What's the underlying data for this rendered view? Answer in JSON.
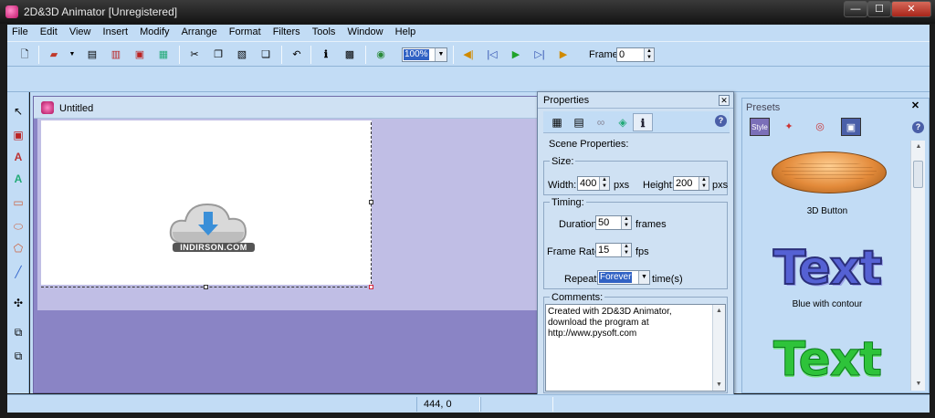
{
  "window": {
    "title": "2D&3D Animator [Unregistered]",
    "min": "—",
    "max": "☐",
    "close": "✕"
  },
  "menu": [
    "File",
    "Edit",
    "View",
    "Insert",
    "Modify",
    "Arrange",
    "Format",
    "Filters",
    "Tools",
    "Window",
    "Help"
  ],
  "toolbar": {
    "zoom_value": "100%",
    "frame_label": "Frame:",
    "frame_value": "0"
  },
  "document": {
    "title": "Untitled",
    "logo_text": "INDIRSON.COM"
  },
  "properties": {
    "title": "Properties",
    "close": "✕",
    "help": "?",
    "scene_label": "Scene Properties:",
    "size": {
      "group": "Size:",
      "width_label": "Width:",
      "width_value": "400",
      "width_unit": "pxs",
      "height_label": "Height:",
      "height_value": "200",
      "height_unit": "pxs"
    },
    "timing": {
      "group": "Timing:",
      "duration_label": "Duration:",
      "duration_value": "50",
      "duration_unit": "frames",
      "framerate_label": "Frame Rate:",
      "framerate_value": "15",
      "framerate_unit": "fps",
      "repeat_label": "Repeat:",
      "repeat_value": "Forever",
      "repeat_unit": "time(s)"
    },
    "comments": {
      "group": "Comments:",
      "text": "Created with 2D&3D Animator, download the program at http://www.pysoft.com"
    }
  },
  "presets": {
    "title": "Presets",
    "close": "✕",
    "help": "?",
    "style_tab": "Style",
    "items": [
      {
        "caption": "3D Button"
      },
      {
        "preview": "Text",
        "caption": "Blue with contour"
      },
      {
        "preview": "Text"
      }
    ]
  },
  "statusbar": {
    "coords": "444, 0"
  }
}
